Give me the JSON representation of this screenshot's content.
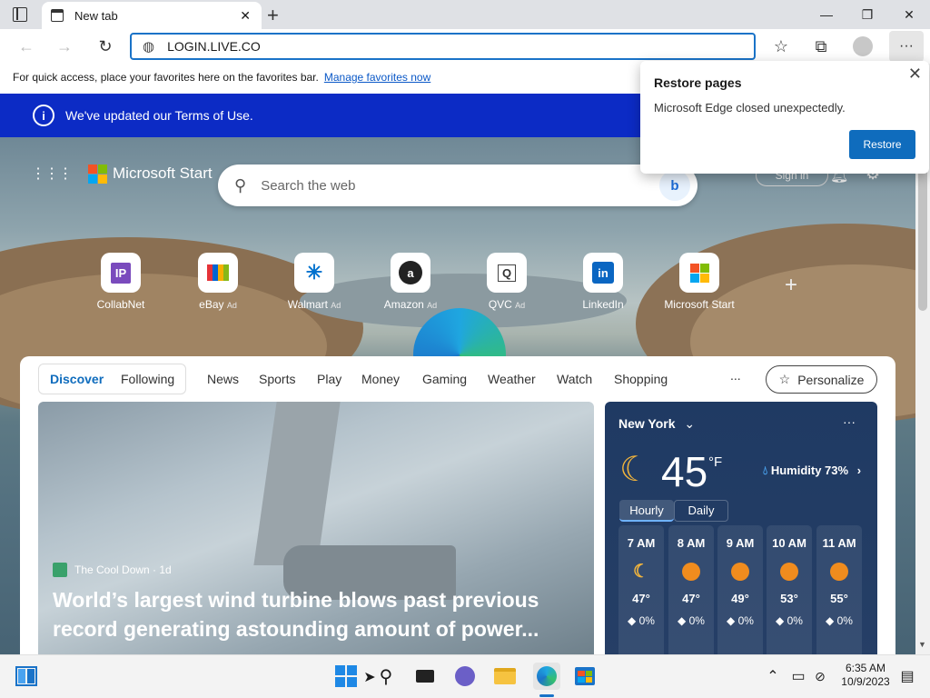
{
  "browser": {
    "tab_title": "New tab",
    "address": "LOGIN.LIVE.CO",
    "favorites_bar_text": "For quick access, place your favorites here on the favorites bar.",
    "favorites_bar_link": "Manage favorites now"
  },
  "notice": {
    "text": "We've updated our Terms of Use."
  },
  "restore_popup": {
    "title": "Restore pages",
    "message": "Microsoft Edge closed unexpectedly.",
    "button": "Restore"
  },
  "start": {
    "brand": "Microsoft Start",
    "search_placeholder": "Search the web",
    "sign_in": "Sign in",
    "quick_links": [
      {
        "label": "CollabNet",
        "ad": "",
        "icon": "IP"
      },
      {
        "label": "eBay",
        "ad": "Ad",
        "icon": "ebay-bag-icon"
      },
      {
        "label": "Walmart",
        "ad": "Ad",
        "icon": "walmart-spark-icon"
      },
      {
        "label": "Amazon",
        "ad": "Ad",
        "icon": "a"
      },
      {
        "label": "QVC",
        "ad": "Ad",
        "icon": "Q"
      },
      {
        "label": "LinkedIn",
        "ad": "",
        "icon": "in"
      },
      {
        "label": "Microsoft Start",
        "ad": "",
        "icon": "microsoft-logo-icon"
      }
    ]
  },
  "feed": {
    "tabs": [
      "Discover",
      "Following"
    ],
    "nav": [
      "News",
      "Sports",
      "Play",
      "Money",
      "Gaming",
      "Weather",
      "Watch",
      "Shopping"
    ],
    "more": "...",
    "personalize": "Personalize"
  },
  "article": {
    "source": "The Cool Down · 1d",
    "headline": "World’s largest wind turbine blows past previous record generating astounding amount of power..."
  },
  "weather": {
    "city": "New York",
    "temp": "45",
    "unit": "°F",
    "humidity": "Humidity 73%",
    "tabs": [
      "Hourly",
      "Daily"
    ],
    "hourly": [
      {
        "time": "7 AM",
        "temp": "47°",
        "precip": "0%",
        "icon": "moon"
      },
      {
        "time": "8 AM",
        "temp": "47°",
        "precip": "0%",
        "icon": "sun"
      },
      {
        "time": "9 AM",
        "temp": "49°",
        "precip": "0%",
        "icon": "sun"
      },
      {
        "time": "10 AM",
        "temp": "53°",
        "precip": "0%",
        "icon": "sun"
      },
      {
        "time": "11 AM",
        "temp": "55°",
        "precip": "0%",
        "icon": "sun"
      }
    ]
  },
  "taskbar": {
    "time": "6:35 AM",
    "date": "10/9/2023"
  }
}
